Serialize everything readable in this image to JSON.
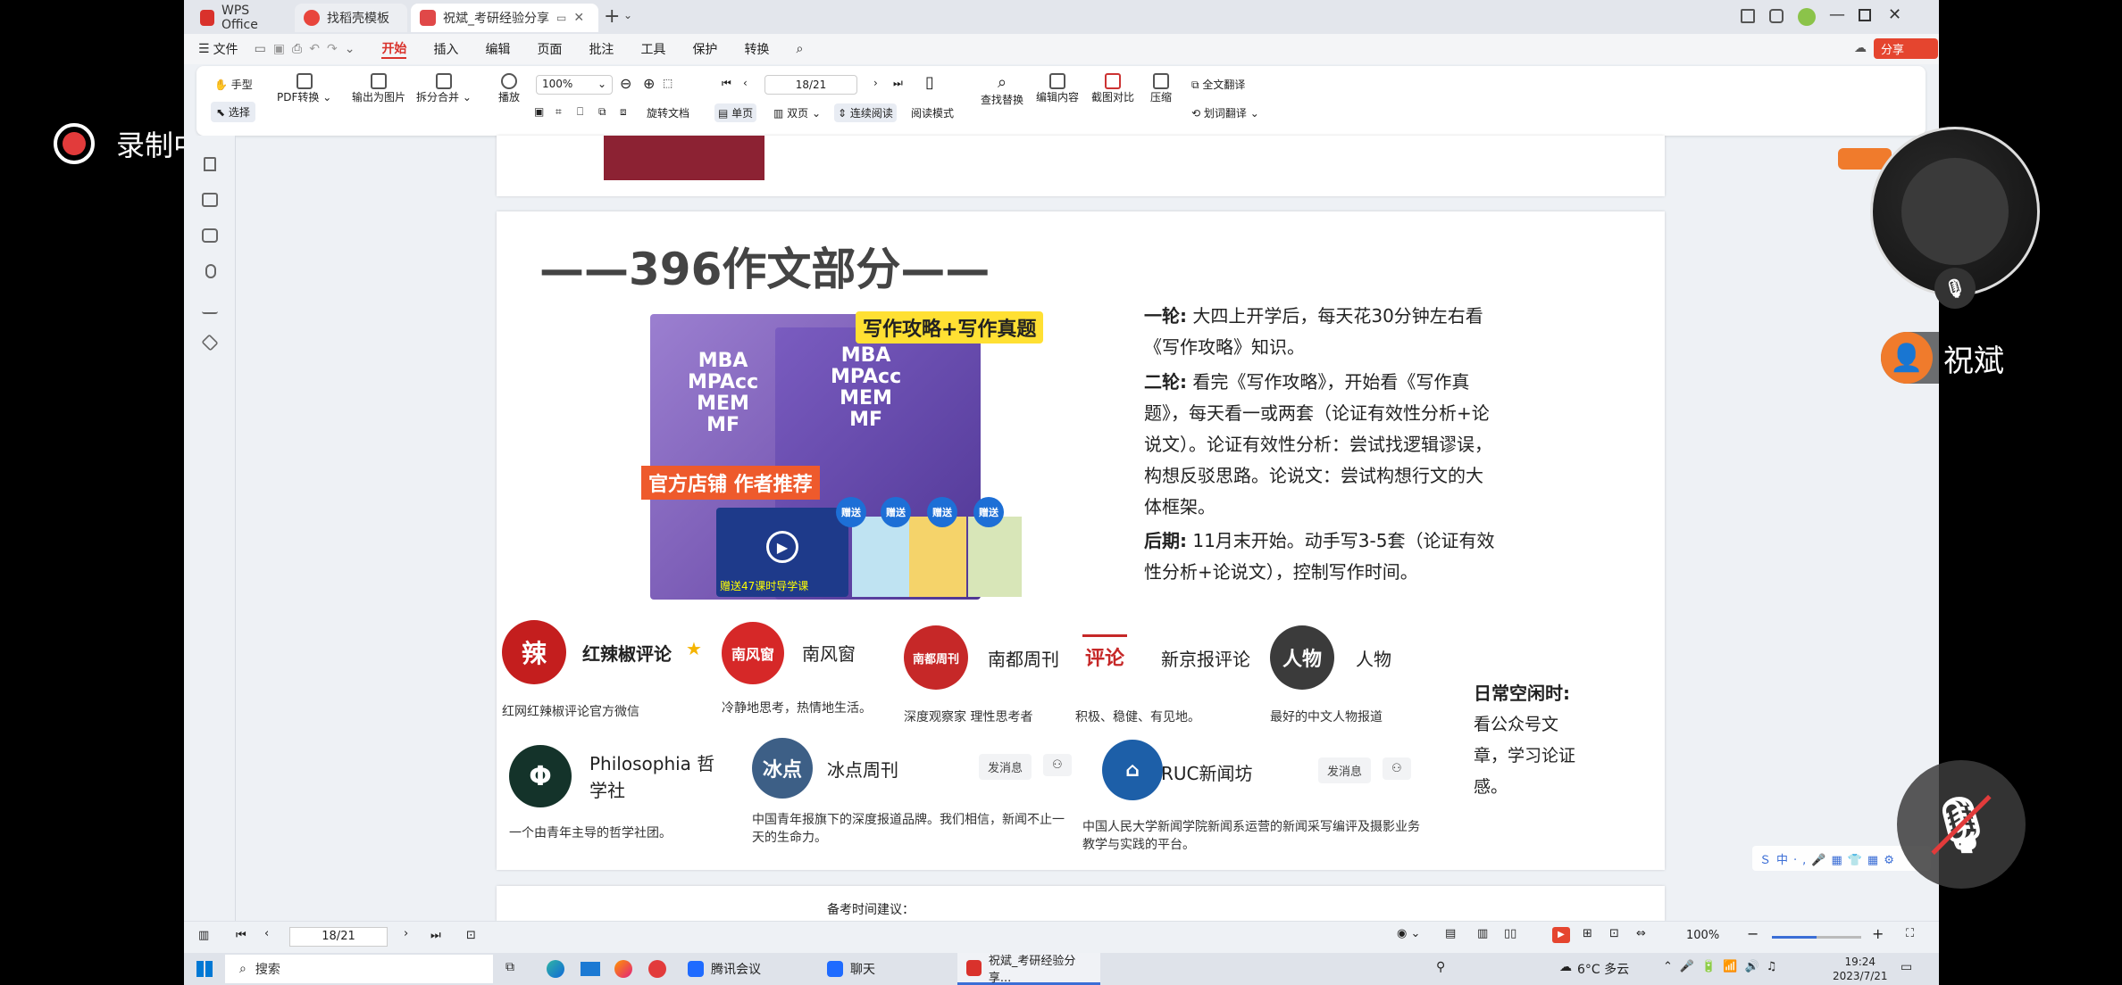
{
  "overlay": {
    "recording": "录制中",
    "participant": "祝斌"
  },
  "tabs": [
    {
      "label": "WPS Office"
    },
    {
      "label": "找稻壳模板"
    },
    {
      "label": "祝斌_考研经验分享"
    }
  ],
  "menu": [
    "文件",
    "开始",
    "插入",
    "编辑",
    "页面",
    "批注",
    "工具",
    "保护",
    "转换"
  ],
  "share_label": "分享",
  "ribbon": {
    "hand": "手型",
    "select": "选择",
    "pdf_convert": "PDF转换",
    "export_image": "输出为图片",
    "split_merge": "拆分合并",
    "play": "播放",
    "zoom": "100%",
    "page": "18/21",
    "rotate": "旋转文档",
    "single": "单页",
    "double": "双页",
    "continuous": "连续阅读",
    "read_mode": "阅读模式",
    "find_replace": "查找替换",
    "edit_content": "编辑内容",
    "compare": "截图对比",
    "compress": "压缩",
    "full_translate": "全文翻译",
    "word_translate": "划词翻译"
  },
  "slide": {
    "heading": "——396作文部分——",
    "book_banner": "写作攻略+写作真题",
    "book_text": "MBA\nMPAcc\nMEM\nMF",
    "book_tag": "官方店铺 作者推荐",
    "gift": "赠送",
    "video_label": "赠送47课时导学课",
    "round1_label": "一轮:",
    "round1": "大四上开学后，每天花30分钟左右看《写作攻略》知识。",
    "round2_label": "二轮:",
    "round2": "看完《写作攻略》，开始看《写作真题》，每天看一或两套（论证有效性分析+论说文）。论证有效性分析：尝试找逻辑谬误，构想反驳思路。论说文：尝试构想行文的大体框架。",
    "late_label": "后期:",
    "late": "11月末开始。动手写3-5套（论证有效性分析+论说文），控制写作时间。",
    "daily_title": "日常空闲时:",
    "daily_text": "看公众号文章，学习论证感。",
    "accounts": [
      {
        "name": "红辣椒评论",
        "desc": "红网红辣椒评论官方微信"
      },
      {
        "name": "南风窗",
        "desc": "冷静地思考，热情地生活。"
      },
      {
        "name": "南都周刊",
        "desc": "深度观察家 理性思考者"
      },
      {
        "name": "新京报评论",
        "desc": "积极、稳健、有见地。"
      },
      {
        "name": "人物",
        "desc": "最好的中文人物报道"
      },
      {
        "name": "Philosophia 哲学社",
        "desc": "一个由青年主导的哲学社团。"
      },
      {
        "name": "冰点周刊",
        "desc": "中国青年报旗下的深度报道品牌。我们相信，新闻不止一天的生命力。"
      },
      {
        "name": "RUC新闻坊",
        "desc": "中国人民大学新闻学院新闻系运营的新闻采写编评及摄影业务教学与实践的平台。"
      }
    ],
    "send_msg": "发消息",
    "next_title": "备考时间建议："
  },
  "status": {
    "page": "18/21",
    "zoom": "100%"
  },
  "taskbar": {
    "search": "搜索",
    "apps": [
      "腾讯会议",
      "聊天",
      "祝斌_考研经验分享..."
    ],
    "weather": "6°C 多云",
    "time": "19:24",
    "date": "2023/7/21"
  }
}
